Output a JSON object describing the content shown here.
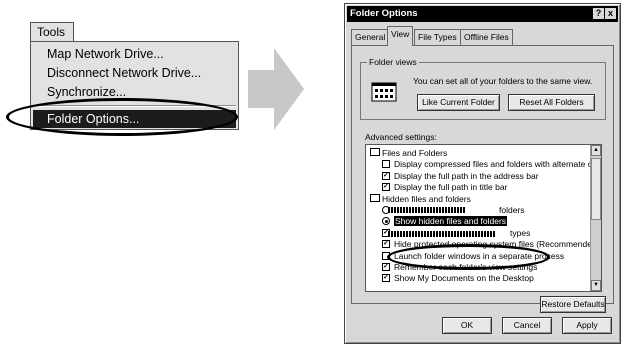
{
  "menu": {
    "tab_label": "Tools",
    "items": [
      "Map Network Drive...",
      "Disconnect Network Drive...",
      "Synchronize..."
    ],
    "selected_label": "Folder Options..."
  },
  "dialog": {
    "title": "Folder Options",
    "help_label": "?",
    "close_label": "x",
    "tabs": [
      "General",
      "View",
      "File Types",
      "Offline Files"
    ],
    "active_tab": "View",
    "folder_views": {
      "legend": "Folder views",
      "description": "You can set all of your folders to the same view.",
      "like_current_label": "Like Current Folder",
      "reset_all_label": "Reset All Folders"
    },
    "advanced": {
      "label": "Advanced settings:",
      "rows": [
        {
          "kind": "folder",
          "text": "Files and Folders"
        },
        {
          "kind": "check",
          "checked": false,
          "text": "Display compressed files and folders with alternate color"
        },
        {
          "kind": "check",
          "checked": true,
          "text": "Display the full path in the address bar"
        },
        {
          "kind": "check",
          "checked": true,
          "text": "Display the full path in title bar"
        },
        {
          "kind": "folder",
          "text": "Hidden files and folders"
        },
        {
          "kind": "radio",
          "checked": false,
          "text": "folders"
        },
        {
          "kind": "radio",
          "checked": true,
          "text": "Show hidden files and folders"
        },
        {
          "kind": "check",
          "checked": true,
          "text": "types"
        },
        {
          "kind": "check",
          "checked": true,
          "text": "Hide protected operating system files (Recommended)"
        },
        {
          "kind": "check",
          "checked": false,
          "text": "Launch folder windows in a separate process"
        },
        {
          "kind": "check",
          "checked": true,
          "text": "Remember each folder's view settings"
        },
        {
          "kind": "check",
          "checked": true,
          "text": "Show My Documents on the Desktop"
        }
      ],
      "scroll_up_glyph": "▲",
      "scroll_down_glyph": "▼"
    },
    "restore_defaults_label": "Restore Defaults",
    "ok_label": "OK",
    "cancel_label": "Cancel",
    "apply_label": "Apply"
  },
  "colors": {
    "menu_bg": "#e2e2e2",
    "selection": "#1c1c1c",
    "dialog_bg": "#d8d8d8",
    "arrow": "#c8c8c8"
  },
  "icons": {
    "arrow": "right-arrow-icon",
    "folder_view": "folder-view-icon",
    "checkmark": "✓"
  }
}
